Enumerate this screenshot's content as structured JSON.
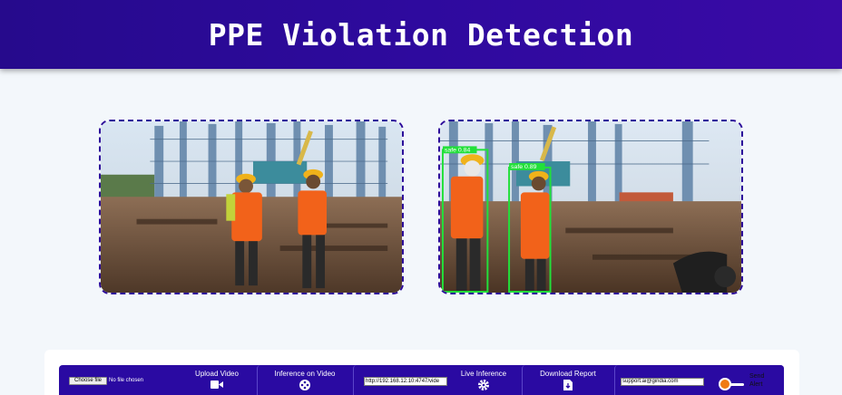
{
  "header": {
    "title": "PPE Violation Detection"
  },
  "input_frame": {
    "description_icon": "site-photo-icon"
  },
  "output_frame": {
    "detections": [
      {
        "label": "safe",
        "confidence": "0.84"
      },
      {
        "label": "safe",
        "confidence": "0.89"
      }
    ],
    "box_color": "#22e03a"
  },
  "toolbar": {
    "choose_file": "Choose file",
    "no_file": "No file chosen",
    "upload_video": "Upload Video",
    "inference_video": "Inference on Video",
    "stream_url": "http://192.168.12.10:4747/vide",
    "live_inference": "Live Inference",
    "download_report": "Download Report",
    "email": "support.ai@gindia.com",
    "send_alert": "Send Alert"
  },
  "colors": {
    "brand": "#2a0aa2",
    "toggle": "#f07a12"
  }
}
